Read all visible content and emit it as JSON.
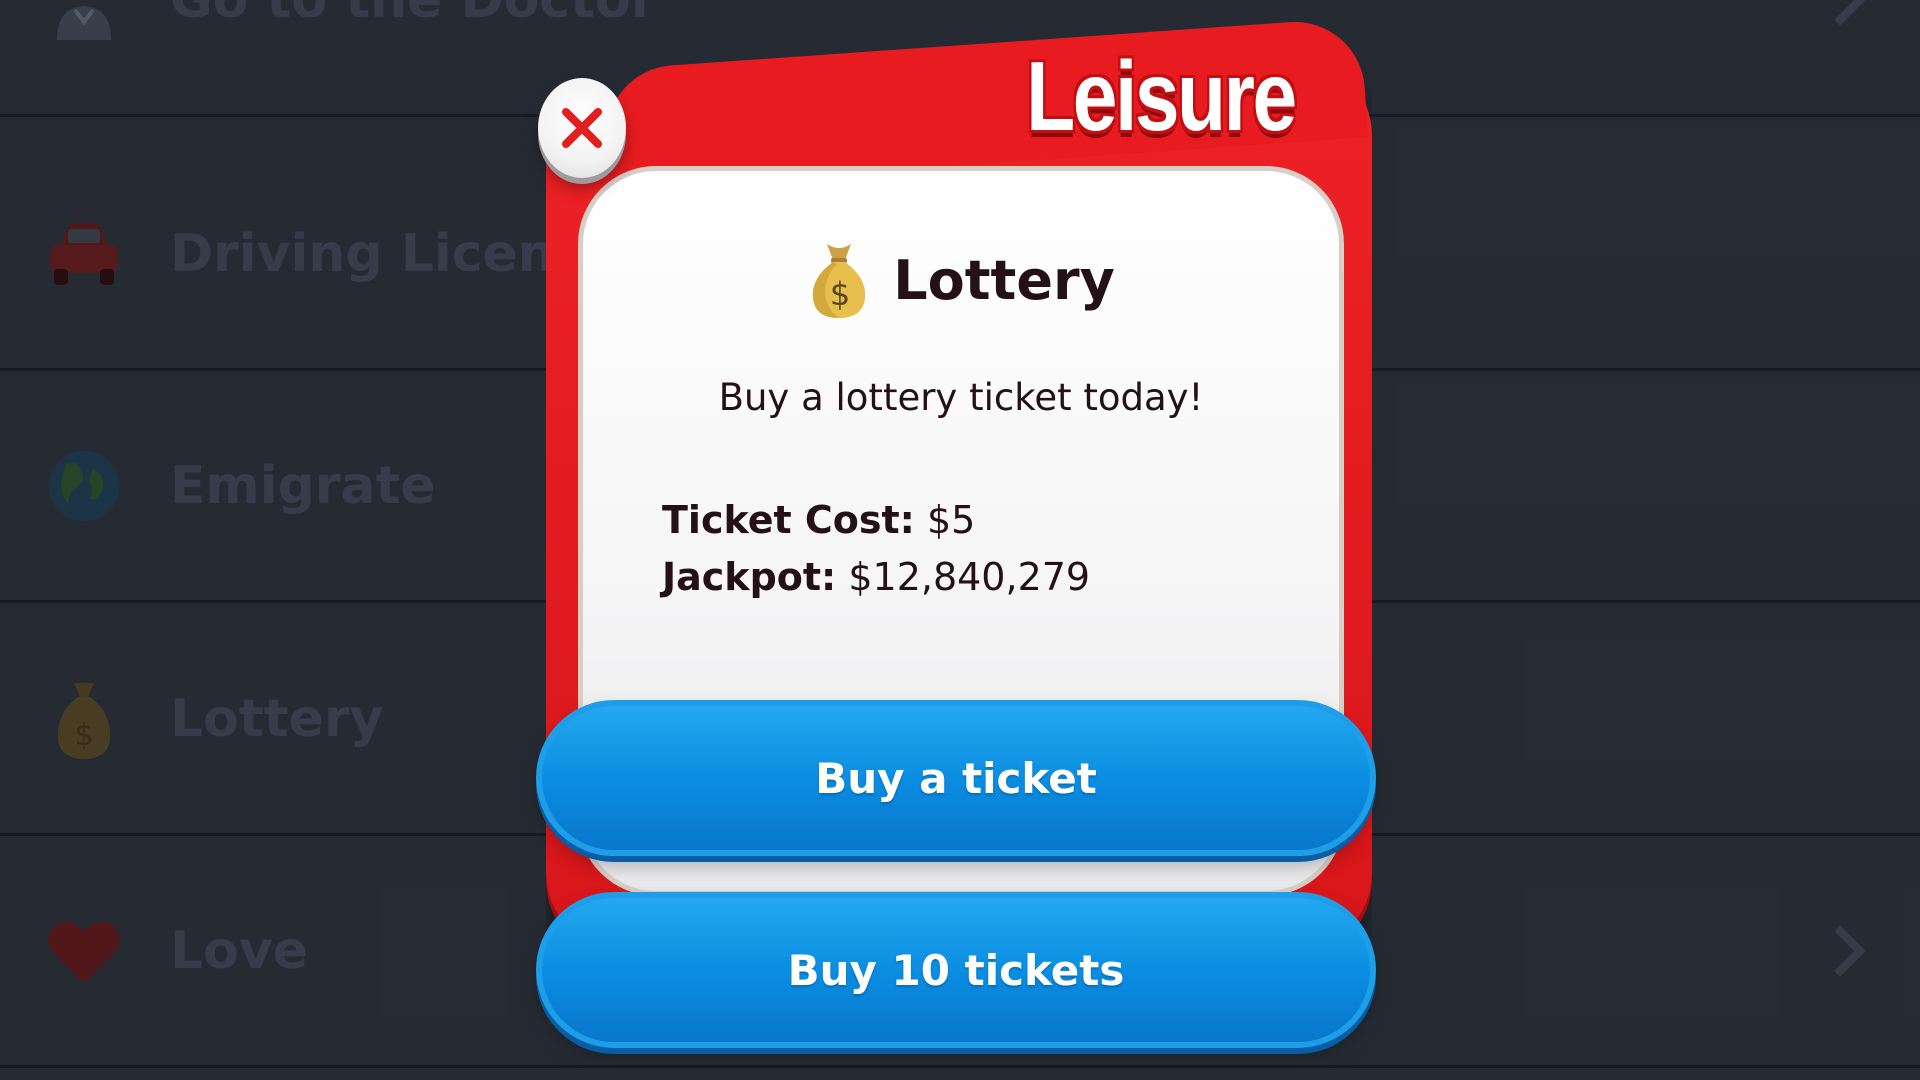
{
  "background_list": {
    "items": [
      {
        "label": "Go to the Doctor",
        "icon": "doctor-icon"
      },
      {
        "label": "Driving License",
        "icon": "car-icon"
      },
      {
        "label": "Emigrate",
        "icon": "globe-icon"
      },
      {
        "label": "Lottery",
        "icon": "money-bag-icon"
      },
      {
        "label": "Love",
        "icon": "heart-icon"
      }
    ]
  },
  "modal": {
    "header": "Leisure",
    "title": "Lottery",
    "title_icon": "money-bag-icon",
    "subtitle": "Buy a lottery ticket today!",
    "ticket_cost_label": "Ticket Cost:",
    "ticket_cost_value": "$5",
    "jackpot_label": "Jackpot:",
    "jackpot_value": "$12,840,279",
    "buy_one_label": "Buy a ticket",
    "buy_ten_label": "Buy 10 tickets",
    "close_icon": "close-icon"
  },
  "colors": {
    "modal_red": "#e81c20",
    "button_blue": "#0a8be0",
    "text_dark": "#241017",
    "list_text_dim": "#3b4250",
    "background": "#2a2f38"
  }
}
